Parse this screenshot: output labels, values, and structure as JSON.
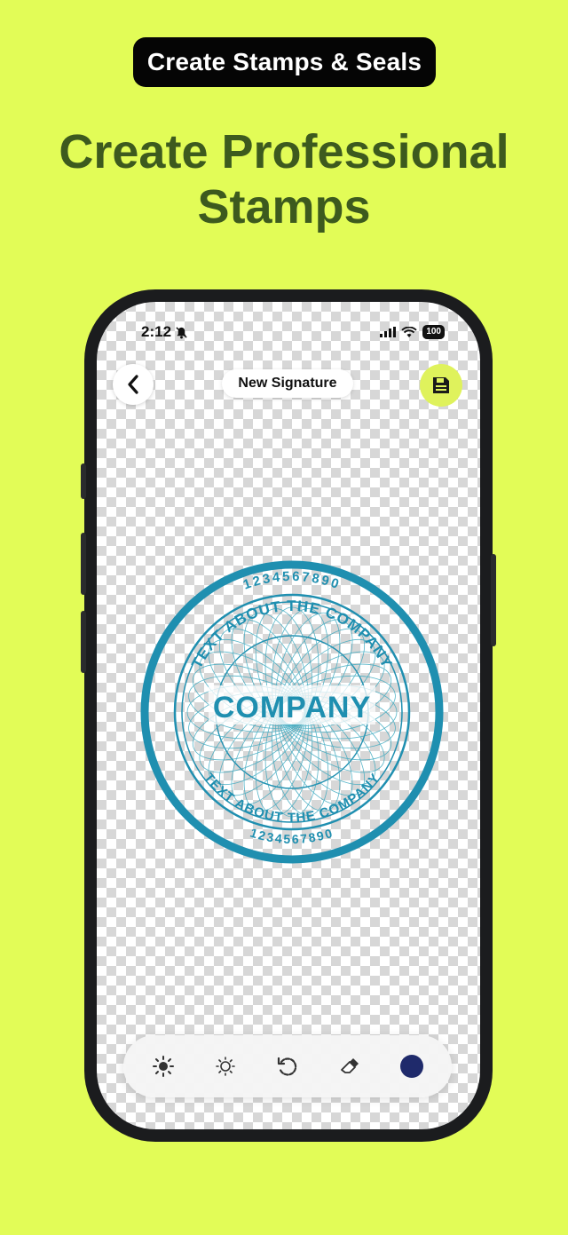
{
  "banner": {
    "label": "Create Stamps & Seals"
  },
  "headline": {
    "line1": "Create Professional",
    "line2": "Stamps"
  },
  "status_bar": {
    "time": "2:12",
    "battery": "100"
  },
  "header": {
    "title": "New Signature",
    "back_icon": "chevron-left-icon",
    "save_icon": "floppy-disk-icon"
  },
  "stamp": {
    "top_numbers": "1234567890",
    "text_arc": "TEXT ABOUT THE COMPANY",
    "center_text": "COMPANY",
    "color": "#1f8fb0"
  },
  "toolbar": {
    "tools": [
      "brightness-icon",
      "contrast-icon",
      "rotate-icon",
      "eraser-icon",
      "color-picker"
    ],
    "selected_color": "#1f2a6b"
  },
  "colors": {
    "background": "#e2fc57",
    "headline": "#3d5a1e",
    "save_button": "#dff25c"
  }
}
